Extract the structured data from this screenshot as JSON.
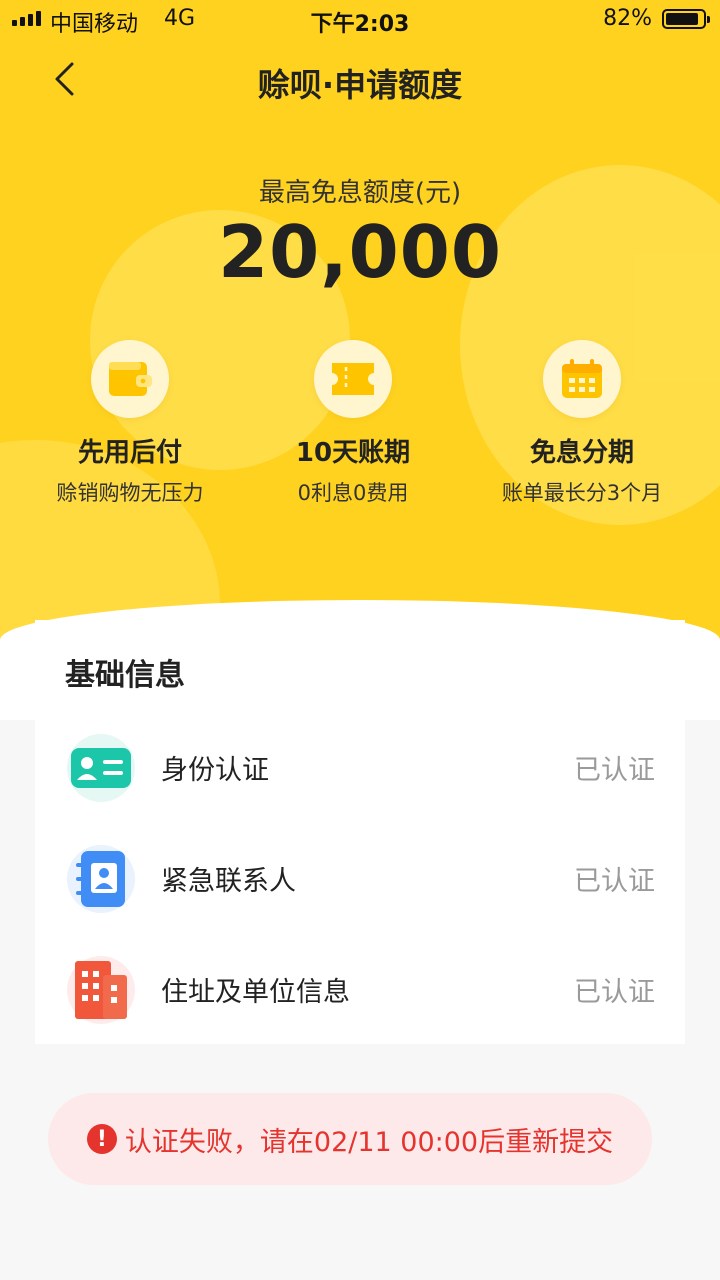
{
  "status_bar": {
    "carrier": "中国移动",
    "network": "4G",
    "time": "下午2:03",
    "battery": "82%"
  },
  "nav": {
    "title": "赊呗·申请额度"
  },
  "limit": {
    "label": "最高免息额度(元)",
    "value": "20,000"
  },
  "features": [
    {
      "title": "先用后付",
      "subtitle": "赊销购物无压力",
      "icon": "wallet-icon"
    },
    {
      "title": "10天账期",
      "subtitle": "0利息0费用",
      "icon": "ticket-icon"
    },
    {
      "title": "免息分期",
      "subtitle": "账单最长分3个月",
      "icon": "calendar-icon"
    }
  ],
  "basic_info": {
    "title": "基础信息",
    "items": [
      {
        "label": "身份认证",
        "status": "已认证",
        "icon": "id-card-icon"
      },
      {
        "label": "紧急联系人",
        "status": "已认证",
        "icon": "contact-book-icon"
      },
      {
        "label": "住址及单位信息",
        "status": "已认证",
        "icon": "building-icon"
      }
    ]
  },
  "alert": {
    "text": "认证失败，请在02/11 00:00后重新提交",
    "color": "#e5342e"
  },
  "colors": {
    "accent": "#ffd21f",
    "error": "#e5342e"
  }
}
